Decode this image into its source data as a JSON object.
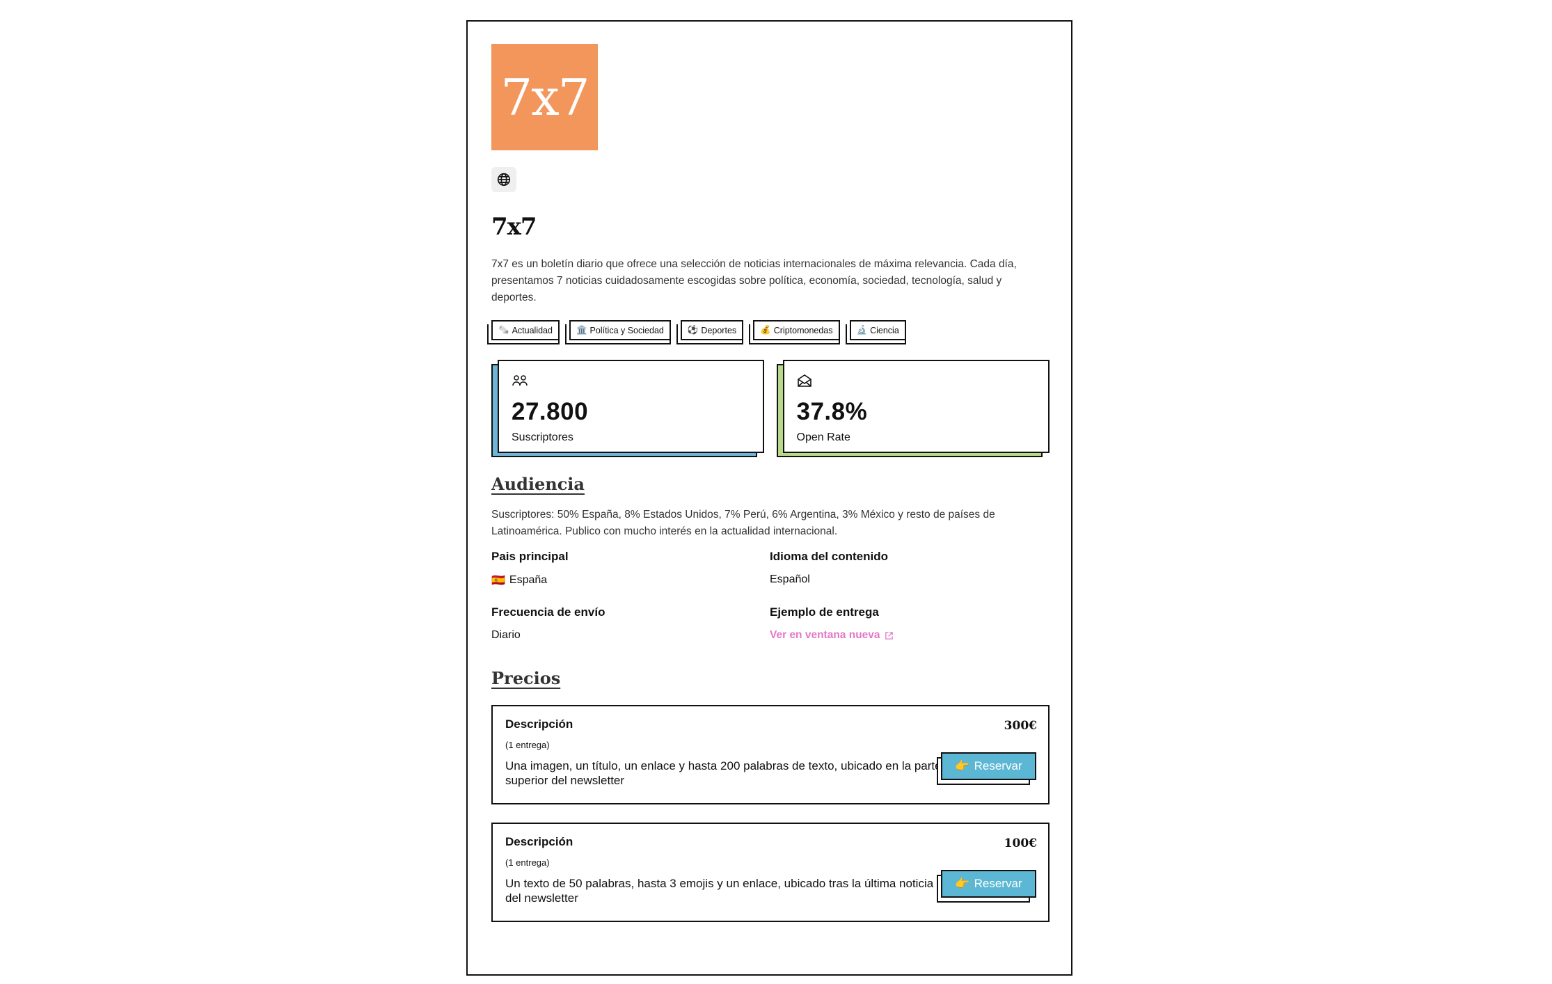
{
  "newsletter": {
    "logo_text": "7x7",
    "logo_color": "#f2965c",
    "title": "7x7",
    "description": "7x7 es un boletín diario que ofrece una selección de noticias internacionales de máxima relevancia. Cada día, presentamos 7 noticias cuidadosamente escogidas sobre política, economía, sociedad, tecnología, salud y deportes.",
    "website_icon": "globe-icon"
  },
  "tags": [
    {
      "emoji": "🗞️",
      "label": "Actualidad"
    },
    {
      "emoji": "🏛️",
      "label": "Política y Sociedad"
    },
    {
      "emoji": "⚽",
      "label": "Deportes"
    },
    {
      "emoji": "💰",
      "label": "Criptomonedas"
    },
    {
      "emoji": "🔬",
      "label": "Ciencia"
    }
  ],
  "stats": {
    "subscribers": {
      "icon": "people-icon",
      "value": "27.800",
      "label": "Suscriptores",
      "accent": "#6fb6d6"
    },
    "open_rate": {
      "icon": "envelope-open-icon",
      "value": "37.8%",
      "label": "Open Rate",
      "accent": "#b9d98a"
    }
  },
  "audience": {
    "heading": "Audiencia",
    "text": "Suscriptores: 50% España, 8% Estados Unidos, 7% Perú, 6% Argentina, 3% México y resto de países de Latinoamérica. Publico con mucho interés en la actualidad internacional.",
    "country_label": "Pais principal",
    "country_flag": "🇪🇸",
    "country_value": "España",
    "language_label": "Idioma del contenido",
    "language_value": "Español",
    "frequency_label": "Frecuencia de envío",
    "frequency_value": "Diario",
    "sample_label": "Ejemplo de entrega",
    "sample_link": "Ver en ventana nueva",
    "link_color": "#e478c8"
  },
  "pricing": {
    "heading": "Precios",
    "items": [
      {
        "title": "Descripción",
        "amount": "300€",
        "deliveries": "(1 entrega)",
        "description": "Una imagen, un título, un enlace y hasta 200 palabras de texto, ubicado en la parte superior del newsletter",
        "button_emoji": "👉",
        "button_label": "Reservar"
      },
      {
        "title": "Descripción",
        "amount": "100€",
        "deliveries": "(1 entrega)",
        "description": "Un texto de 50 palabras, hasta 3 emojis y un enlace, ubicado tras la última noticia del newsletter",
        "button_emoji": "👉",
        "button_label": "Reservar"
      }
    ],
    "button_color": "#5cb7d5"
  }
}
